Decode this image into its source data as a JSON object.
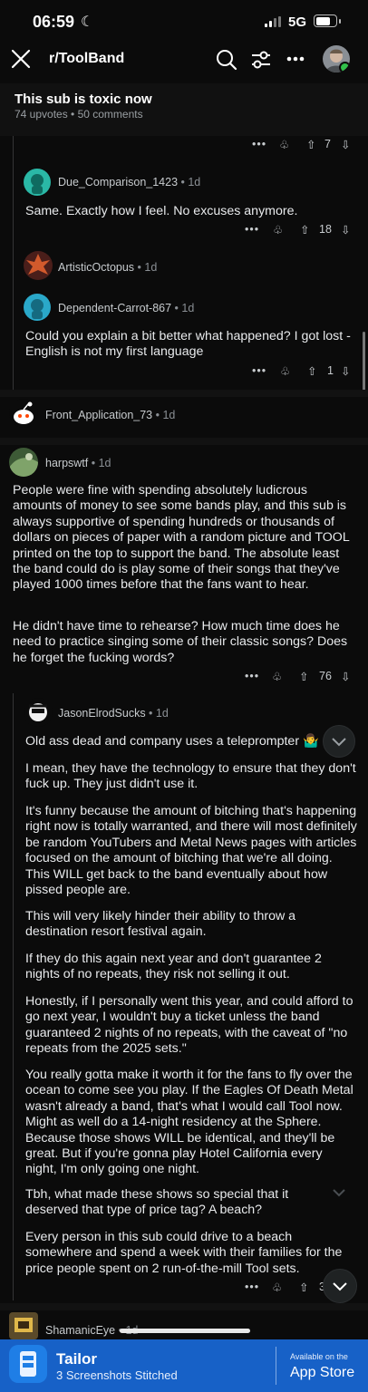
{
  "status_bar": {
    "time": "06:59",
    "network": "5G"
  },
  "header": {
    "subreddit": "r/ToolBand"
  },
  "post": {
    "title": "This sub is toxic now",
    "meta": "74 upvotes • 50 comments"
  },
  "icons": {
    "close": "close-icon",
    "search": "search-icon",
    "filter": "sliders-icon",
    "more": "more-icon",
    "award": "award-icon",
    "upvote": "upvote-icon",
    "downvote": "downvote-icon"
  },
  "common": {
    "dots": "•••"
  },
  "comments": {
    "c0": {
      "votes": "7"
    },
    "c1": {
      "user": "Due_Comparison_1423",
      "age": " • 1d",
      "text": "Same. Exactly how I feel. No excuses anymore.",
      "votes": "18"
    },
    "c2": {
      "user": "ArtisticOctopus",
      "age": " • 1d"
    },
    "c3": {
      "user": "Dependent-Carrot-867",
      "age": " • 1d",
      "text": "Could you explain a bit better what happened? I got lost - English is not my first language",
      "votes": "1"
    },
    "c4": {
      "user": "Front_Application_73",
      "age": " • 1d"
    },
    "c5": {
      "user": "harpswtf",
      "age": " • 1d",
      "p1": "People were fine with spending absolutely ludicrous amounts of money to see some bands play, and this sub is always supportive of spending hundreds or thousands of dollars on pieces of paper with a random picture and TOOL printed on the top to support the band. The absolute least the band could do is play some of their songs that they've played 1000 times before that the fans want to hear.",
      "p2": "He didn't have time to rehearse? How much time does he need to practice singing some of their classic songs? Does he forget the fucking words?",
      "votes": "76"
    },
    "c6": {
      "user": "JasonElrodSucks",
      "age": " • 1d",
      "p1": "Old ass dead and company uses a teleprompter 🤷‍♂️",
      "p2": "I mean, they have the technology to ensure that they don't fuck up. They just didn't use it.",
      "p3": "It's funny because the amount of bitching that's happening right now is totally warranted, and there will most definitely be random YouTubers and Metal News pages with articles focused on the amount of bitching that we're all doing. This WILL get back to the band eventually about how pissed people are.",
      "p4": "This will very likely hinder their ability to throw a destination resort festival again.",
      "p5": "If they do this again next year and don't guarantee 2 nights of no repeats, they risk not selling it out.",
      "p6": "Honestly, if I personally went this year, and could afford to go next year, I wouldn't buy a ticket unless the band guaranteed 2 nights of no repeats, with the caveat of \"no repeats from the 2025 sets.\"",
      "p7": "You really gotta make it worth it for the fans to fly over the ocean to come see you play. If the Eagles Of Death Metal wasn't already a band, that's what I would call Tool now. Might as well do a 14-night residency at the Sphere. Because those shows WILL be identical, and they'll be great. But if you're gonna play Hotel California every night, I'm only going one night.",
      "p8": "Tbh, what made these shows so special that it deserved that type of price tag? A beach?",
      "p9": "Every person in this sub could drive to a beach somewhere and spend a week with their families for the price people spent on 2 run-of-the-mill Tool sets.",
      "votes": "3"
    },
    "c7": {
      "user": "ShamanicEye",
      "age": " • 1d"
    }
  },
  "tailor": {
    "title": "Tailor",
    "subtitle": "3 Screenshots Stitched",
    "store_small": "Available on the",
    "store_big": "App Store"
  },
  "colors": {
    "background": "#0b0b0b",
    "tailor_blue": "#1761c7",
    "online": "#31c14a"
  }
}
